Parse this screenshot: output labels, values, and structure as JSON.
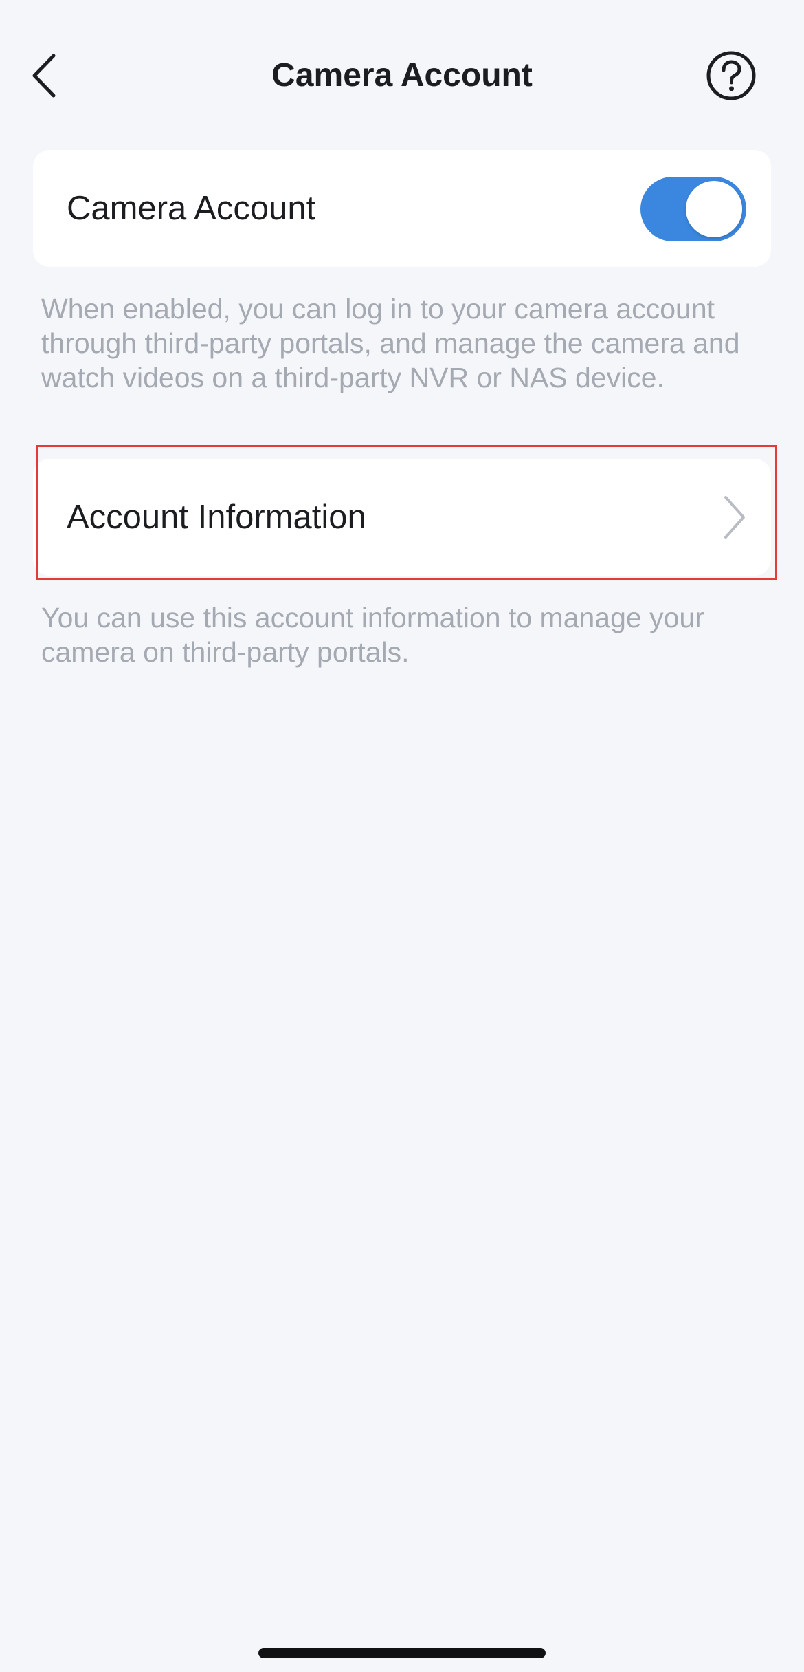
{
  "header": {
    "title": "Camera Account",
    "back_icon": "chevron-left-icon",
    "help_icon": "question-circle-icon"
  },
  "camera_account": {
    "label": "Camera Account",
    "enabled": true,
    "toggle_color": "#3b86de",
    "description": "When enabled, you can log in to your camera account through third-party portals, and manage the camera and watch videos on a third-party NVR or NAS device."
  },
  "account_information": {
    "label": "Account Information",
    "chevron_icon": "chevron-right-icon",
    "description": "You can use this account information to manage your camera on third-party portals.",
    "highlight_color": "#e43b38"
  }
}
